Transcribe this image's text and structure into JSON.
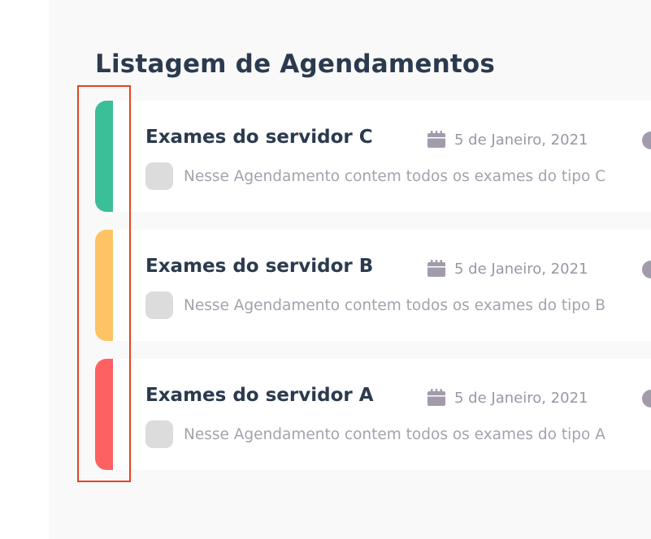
{
  "page": {
    "title": "Listagem de Agendamentos"
  },
  "appointments": [
    {
      "title": "Exames do servidor C",
      "date": "5 de Janeiro, 2021",
      "description": "Nesse Agendamento contem todos os exames do tipo C",
      "color": "#3bbf98"
    },
    {
      "title": "Exames do servidor B",
      "date": "5 de Janeiro, 2021",
      "description": "Nesse Agendamento contem todos os exames do tipo B",
      "color": "#fdc364"
    },
    {
      "title": "Exames do servidor A",
      "date": "5 de Janeiro, 2021",
      "description": "Nesse Agendamento contem todos os exames do tipo A",
      "color": "#fe6161"
    }
  ],
  "icons": {
    "date": "calendar-icon",
    "status": "status-dot-icon",
    "description": "avatar-placeholder"
  },
  "colors": {
    "title": "#2b3a4e",
    "muted": "#9b95a6",
    "highlight": "#e5421d",
    "panel": "#f9f9f9"
  }
}
